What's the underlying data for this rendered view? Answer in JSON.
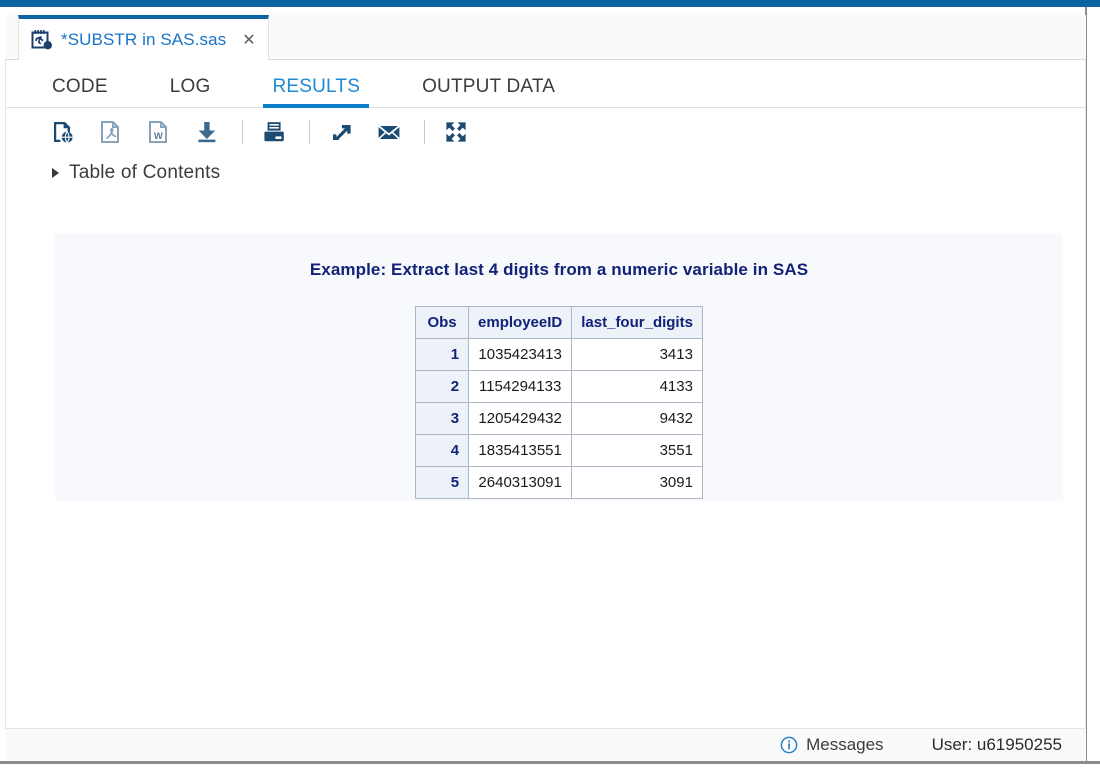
{
  "window": {
    "accent_color": "#0a64a4"
  },
  "file_tab": {
    "icon": "sas-program-icon",
    "title": "*SUBSTR in SAS.sas",
    "close_label": "✕"
  },
  "view_tabs": [
    {
      "label": "CODE",
      "active": false
    },
    {
      "label": "LOG",
      "active": false
    },
    {
      "label": "RESULTS",
      "active": true
    },
    {
      "label": "OUTPUT DATA",
      "active": false
    }
  ],
  "toolbar": {
    "buttons": [
      {
        "name": "save-html-icon",
        "title": "Save results as HTML",
        "enabled": true
      },
      {
        "name": "save-pdf-icon",
        "title": "Save results as PDF",
        "enabled": false
      },
      {
        "name": "save-word-icon",
        "title": "Save results as Word",
        "enabled": false
      },
      {
        "name": "download-icon",
        "title": "Download results",
        "enabled": false
      },
      {
        "name": "print-icon",
        "title": "Print",
        "enabled": true
      },
      {
        "name": "open-in-new-window-icon",
        "title": "Open in new window",
        "enabled": true
      },
      {
        "name": "email-icon",
        "title": "Email results",
        "enabled": true
      },
      {
        "name": "maximize-icon",
        "title": "Maximize view",
        "enabled": true
      }
    ]
  },
  "table_of_contents": {
    "label": "Table of Contents",
    "expanded": false
  },
  "results": {
    "title": "Example: Extract last 4 digits from a numeric variable in SAS",
    "table": {
      "headers": [
        "Obs",
        "employeeID",
        "last_four_digits"
      ],
      "rows": [
        {
          "obs": "1",
          "employeeID": "1035423413",
          "last_four_digits": "3413"
        },
        {
          "obs": "2",
          "employeeID": "1154294133",
          "last_four_digits": "4133"
        },
        {
          "obs": "3",
          "employeeID": "1205429432",
          "last_four_digits": "9432"
        },
        {
          "obs": "4",
          "employeeID": "1835413551",
          "last_four_digits": "3551"
        },
        {
          "obs": "5",
          "employeeID": "2640313091",
          "last_four_digits": "3091"
        }
      ]
    }
  },
  "status_bar": {
    "messages_label": "Messages",
    "messages_icon": "info-icon",
    "user_label": "User: u61950255"
  }
}
